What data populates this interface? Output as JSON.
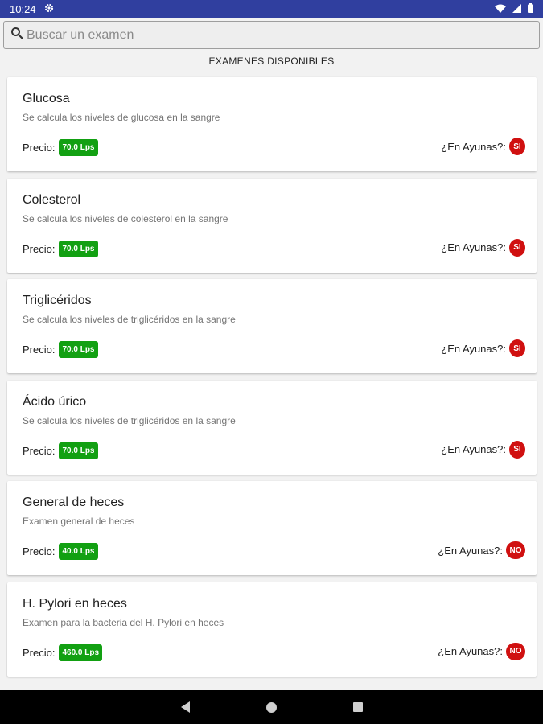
{
  "status_bar": {
    "time": "10:24",
    "icons": [
      "gear-icon",
      "wifi-icon",
      "signal-icon",
      "battery-icon"
    ]
  },
  "search": {
    "placeholder": "Buscar un examen",
    "value": ""
  },
  "section_title": "EXAMENES DISPONIBLES",
  "labels": {
    "price": "Precio:",
    "fasting": "¿En Ayunas?:"
  },
  "exams": [
    {
      "title": "Glucosa",
      "desc": "Se calcula los niveles de glucosa en la sangre",
      "price": "70.0 Lps",
      "fasting": "SI"
    },
    {
      "title": "Colesterol",
      "desc": "Se calcula los niveles de colesterol en la sangre",
      "price": "70.0 Lps",
      "fasting": "SI"
    },
    {
      "title": "Triglicéridos",
      "desc": "Se calcula los niveles de triglicéridos en la sangre",
      "price": "70.0 Lps",
      "fasting": "SI"
    },
    {
      "title": "Ácido úrico",
      "desc": "Se calcula los niveles de triglicéridos en la sangre",
      "price": "70.0 Lps",
      "fasting": "SI"
    },
    {
      "title": "General de heces",
      "desc": "Examen general de heces",
      "price": "40.0 Lps",
      "fasting": "NO"
    },
    {
      "title": "H. Pylori en heces",
      "desc": "Examen para la bacteria del H. Pylori en heces",
      "price": "460.0 Lps",
      "fasting": "NO"
    }
  ],
  "colors": {
    "status_bar": "#303f9f",
    "price_badge": "#12a012",
    "fasting_badge": "#d01010"
  }
}
